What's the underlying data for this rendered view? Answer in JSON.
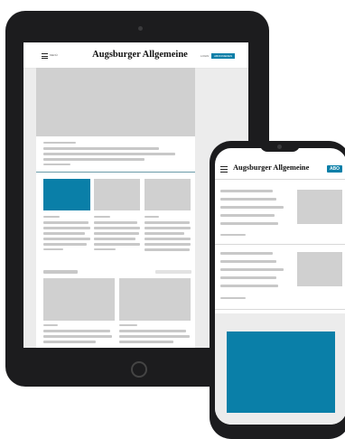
{
  "tablet": {
    "header": {
      "menu_label": "MENÜ",
      "logo": "Augsburger Allgemeine",
      "login_label": "LOGIN",
      "abo_label": "ABONNIEREN"
    }
  },
  "phone": {
    "header": {
      "logo": "Augsburger Allgemeine",
      "abo_label": "ABO"
    }
  },
  "colors": {
    "accent": "#0a7fa8",
    "placeholder": "#d0d0d0",
    "device_frame": "#1c1c1e",
    "page_background": "#ececec"
  }
}
